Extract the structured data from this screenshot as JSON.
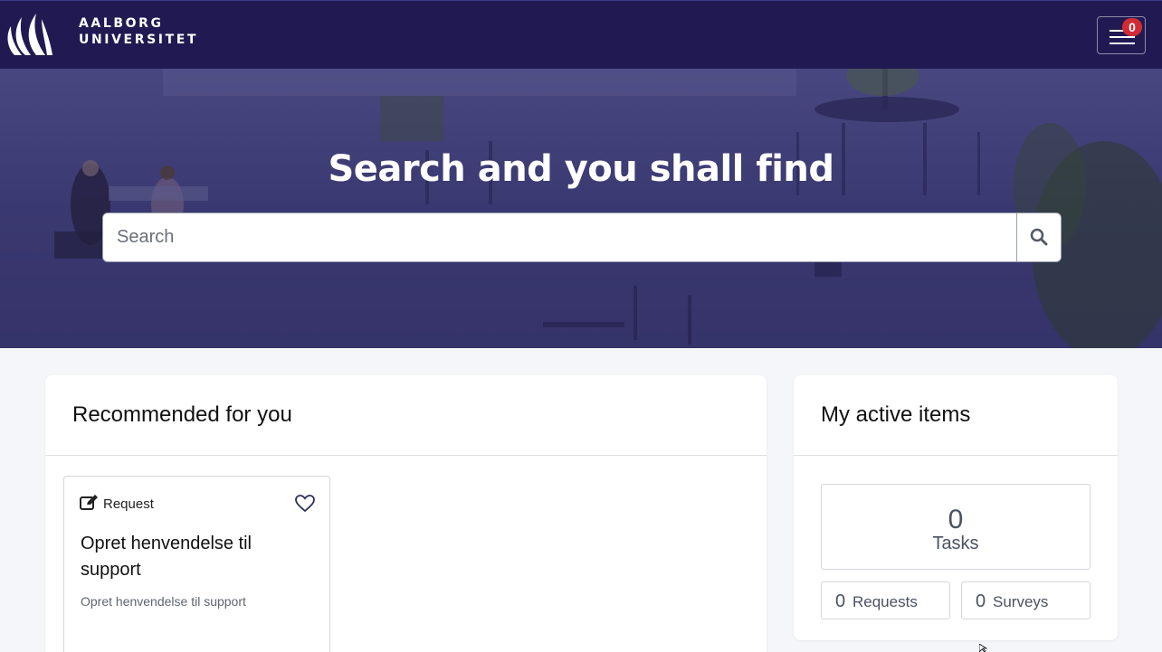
{
  "header": {
    "brand_line1": "AALBORG",
    "brand_line2": "UNIVERSITET",
    "notification_count": "0"
  },
  "hero": {
    "title": "Search and you shall find",
    "search_placeholder": "Search"
  },
  "recommended": {
    "title": "Recommended for you",
    "items": [
      {
        "type": "Request",
        "title": "Opret henvendelse til support",
        "description": "Opret henvendelse til support"
      }
    ]
  },
  "active_items": {
    "title": "My active items",
    "tasks": {
      "count": "0",
      "label": "Tasks"
    },
    "requests": {
      "count": "0",
      "label": "Requests"
    },
    "surveys": {
      "count": "0",
      "label": "Surveys"
    }
  },
  "colors": {
    "header_bg": "#211a52",
    "badge_red": "#d12c36",
    "page_bg": "#f5f6f9"
  }
}
